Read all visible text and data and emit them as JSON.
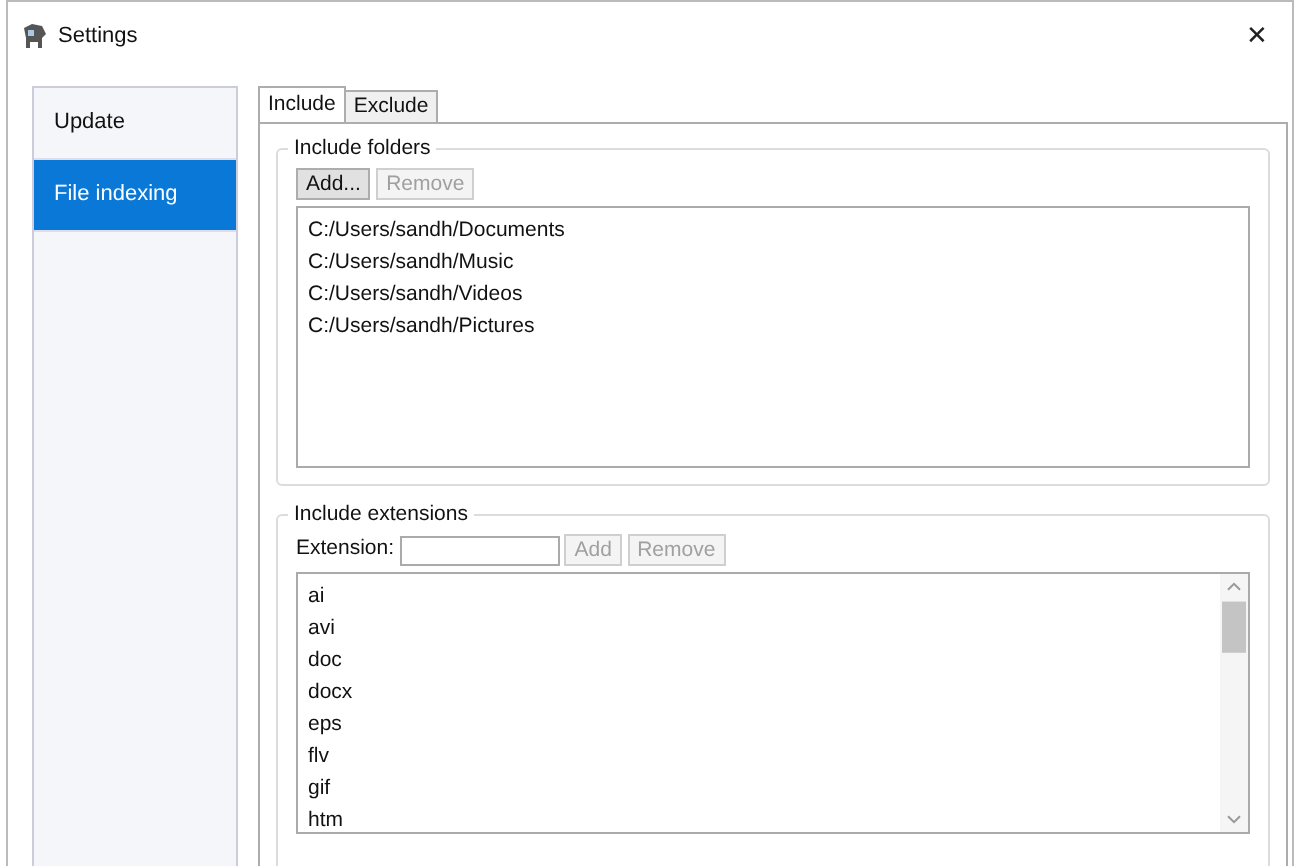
{
  "window": {
    "title": "Settings",
    "close": "✕"
  },
  "sidebar": {
    "items": [
      {
        "label": "Update",
        "selected": false
      },
      {
        "label": "File indexing",
        "selected": true
      }
    ]
  },
  "tabs": [
    {
      "label": "Include",
      "selected": true
    },
    {
      "label": "Exclude",
      "selected": false
    }
  ],
  "include_folders": {
    "title": "Include folders",
    "buttons": [
      {
        "label": "Add...",
        "disabled": false
      },
      {
        "label": "Remove",
        "disabled": true
      }
    ],
    "items": [
      "C:/Users/sandh/Documents",
      "C:/Users/sandh/Music",
      "C:/Users/sandh/Videos",
      "C:/Users/sandh/Pictures"
    ]
  },
  "include_extensions": {
    "title": "Include extensions",
    "field_label": "Extension:",
    "buttons": [
      {
        "label": "Add",
        "disabled": true
      },
      {
        "label": "Remove",
        "disabled": true
      }
    ],
    "items": [
      "ai",
      "avi",
      "doc",
      "docx",
      "eps",
      "flv",
      "gif",
      "htm"
    ]
  }
}
